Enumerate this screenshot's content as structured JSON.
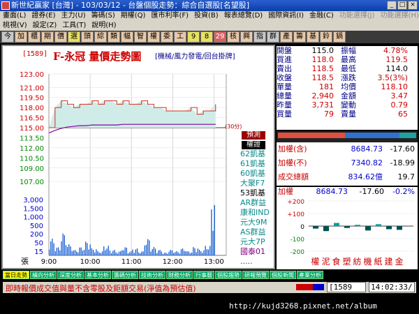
{
  "window": {
    "title": "新世紀贏家 [台灣] - 103/03/12 - 台盤個股走勢：綜合自選股[名望股]"
  },
  "menu1": [
    "畫面(L)",
    "證券(E)",
    "主力(U)",
    "籌碼(S)",
    "期權(Q)",
    "匯市利率(F)",
    "投資(B)",
    "報表總覽(D)",
    "國際資訊(I)",
    "金融(C)",
    "功能選擇(J)",
    "功能選擇(H)"
  ],
  "menu2": [
    "桃視(V)",
    "設定(Z)",
    "工具(T)",
    "說明(H)"
  ],
  "toolbar": [
    "今",
    "加",
    "櫃",
    "期",
    "價",
    "選",
    "頭",
    "綜",
    "類",
    "幅",
    "智",
    "權",
    "委",
    "工",
    "9",
    "8",
    "29",
    "核",
    "興",
    "指",
    "群",
    "產",
    "籌",
    "基",
    "鈴",
    "鍋"
  ],
  "stock": {
    "code": "[1589]",
    "title": "F-永冠  量價走勢圖",
    "subtitle": "[機械/風力發電/回台掛牌]"
  },
  "chart_data": {
    "type": "line",
    "price": {
      "yticks": [
        "123.00",
        "121.00",
        "119.50",
        "118.00",
        "116.50",
        "115.00",
        "113.50",
        "112.00",
        "110.50",
        "109.00",
        "107.00"
      ],
      "ylim": [
        107,
        123
      ],
      "reference": 115.0,
      "x": [
        "9:00",
        "9:10",
        "9:20",
        "9:30",
        "9:40",
        "9:50",
        "10:00",
        "10:10",
        "10:20",
        "10:30",
        "10:40",
        "10:50",
        "11:00",
        "11:10",
        "11:20",
        "11:30",
        "11:40",
        "11:50",
        "12:00",
        "12:10",
        "12:20",
        "12:30",
        "12:40",
        "12:50",
        "13:00",
        "13:10",
        "13:20",
        "13:30"
      ],
      "values": [
        115.0,
        118.0,
        119.0,
        118.5,
        118.0,
        118.5,
        118.5,
        119.0,
        118.5,
        119.0,
        119.0,
        118.5,
        119.0,
        118.5,
        118.5,
        119.0,
        118.5,
        118.0,
        118.0,
        117.5,
        117.5,
        117.5,
        117.5,
        118.0,
        117.0,
        117.5,
        117.5,
        118.5
      ],
      "avg_values": [
        114.2,
        114.6,
        114.9,
        115.1,
        115.2,
        115.3,
        115.3,
        115.4,
        115.4,
        115.4,
        115.4,
        115.4,
        115.5,
        115.5,
        115.5,
        115.5,
        115.5,
        115.5,
        115.5,
        115.5,
        115.5,
        115.5,
        115.5,
        115.5,
        115.5,
        115.5,
        115.5,
        115.5
      ]
    },
    "volume": {
      "yticks": [
        "3,000",
        "1,500",
        "1,000",
        "500",
        "200",
        "50",
        "15"
      ],
      "unit": "張",
      "values": [
        60,
        30,
        80,
        40,
        20,
        30,
        50,
        25,
        15,
        35,
        20,
        15,
        30,
        15,
        25,
        15,
        60,
        30,
        20,
        10,
        20,
        15,
        25,
        15,
        30,
        20,
        35,
        180
      ]
    },
    "xticks": [
      "9:00",
      "10:00",
      "11:00",
      "12:00",
      "13:00"
    ]
  },
  "indicator_label": "(30分)",
  "brokers": {
    "box1": "預測",
    "box2": "權證",
    "items": [
      "62凱基",
      "61凱基",
      "60凱基",
      "大聚F7",
      "53凱基",
      "AR群益",
      "康和IND",
      "元大9M",
      "AS群益",
      "元大7P",
      "國泰01",
      "....."
    ]
  },
  "quote": [
    {
      "l": "開盤",
      "v": "115.0",
      "l2": "振幅",
      "v2": "4.78%"
    },
    {
      "l": "買進",
      "v": "118.0",
      "l2": "最高",
      "v2": "119.5"
    },
    {
      "l": "賣出",
      "v": "118.5",
      "l2": "最低",
      "v2": "114.0"
    },
    {
      "l": "收盤",
      "v": "118.5",
      "l2": "漲跌",
      "v2": "3.5(3%)"
    },
    {
      "l": "單量",
      "v": "181",
      "l2": "均價",
      "v2": "118.10"
    },
    {
      "l": "總量",
      "v": "2,940",
      "l2": "金額",
      "v2": "3.47"
    },
    {
      "l": "昨量",
      "v": "3,731",
      "l2": "變動",
      "v2": "0.79"
    },
    {
      "l": "買量",
      "v": "79",
      "l2": "賣量",
      "v2": "65"
    }
  ],
  "index": [
    {
      "l": "加權(含)",
      "v": "8684.73",
      "c": "-17.60"
    },
    {
      "l": "加權(不)",
      "v": "7340.82",
      "c": "-18.99"
    },
    {
      "l": "成交總額",
      "v": "834.62億",
      "c": "19.7"
    }
  ],
  "sector": {
    "head": {
      "l": "加權",
      "v": "8684.73",
      "c": "-17.60",
      "p": "-0.2%"
    },
    "yticks": [
      "+200",
      "+100",
      "0",
      "-100",
      "-200"
    ],
    "values": [
      -20,
      -40,
      25,
      -15,
      10,
      -35,
      15,
      -25,
      -30
    ],
    "labels": [
      "權",
      "泥",
      "食",
      "塑",
      "紡",
      "機",
      "紙",
      "建",
      "金"
    ]
  },
  "tabs": [
    "當日走勢",
    "橫向分析",
    "深度分析",
    "基本分析",
    "籌碼分析",
    "技術分析",
    "財務分析",
    "行事曆",
    "個股趨勢",
    "研報預覽",
    "個股新聞",
    "產業分析"
  ],
  "status": {
    "message": "即時報價成交值與量不含零股及鉅額交易(淨值為預估值)",
    "code": "[1589",
    "time": "14:02:33/"
  },
  "watermark": "http://kujd3268.pixnet.net/album"
}
